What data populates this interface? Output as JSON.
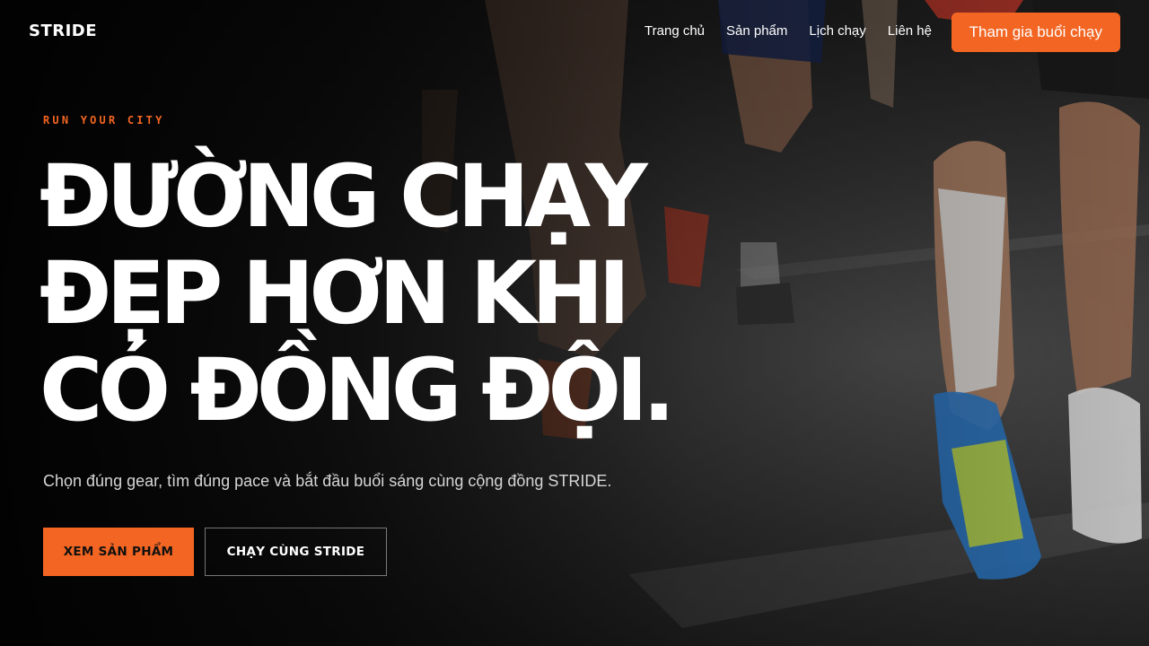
{
  "nav": {
    "logo": "STRIDE",
    "links": [
      "Trang chủ",
      "Sản phẩm",
      "Lịch chạy",
      "Liên hệ"
    ],
    "cta": "Tham gia buổi chạy"
  },
  "hero": {
    "eyebrow": "RUN YOUR CITY",
    "headline": [
      "ĐƯỜNG CHẠY",
      "ĐẸP HƠN KHI",
      "CÓ ĐỒNG ĐỘI."
    ],
    "subtitle": "Chọn đúng gear, tìm đúng pace và bắt đầu buổi sáng cùng cộng đồng STRIDE.",
    "primary_button": "XEM SẢN PHẨM",
    "secondary_button": "CHẠY CÙNG STRIDE",
    "background_image": "runners-on-road-photo"
  },
  "colors": {
    "accent": "#f26522",
    "background": "#0a0a0a",
    "text": "#ffffff"
  }
}
